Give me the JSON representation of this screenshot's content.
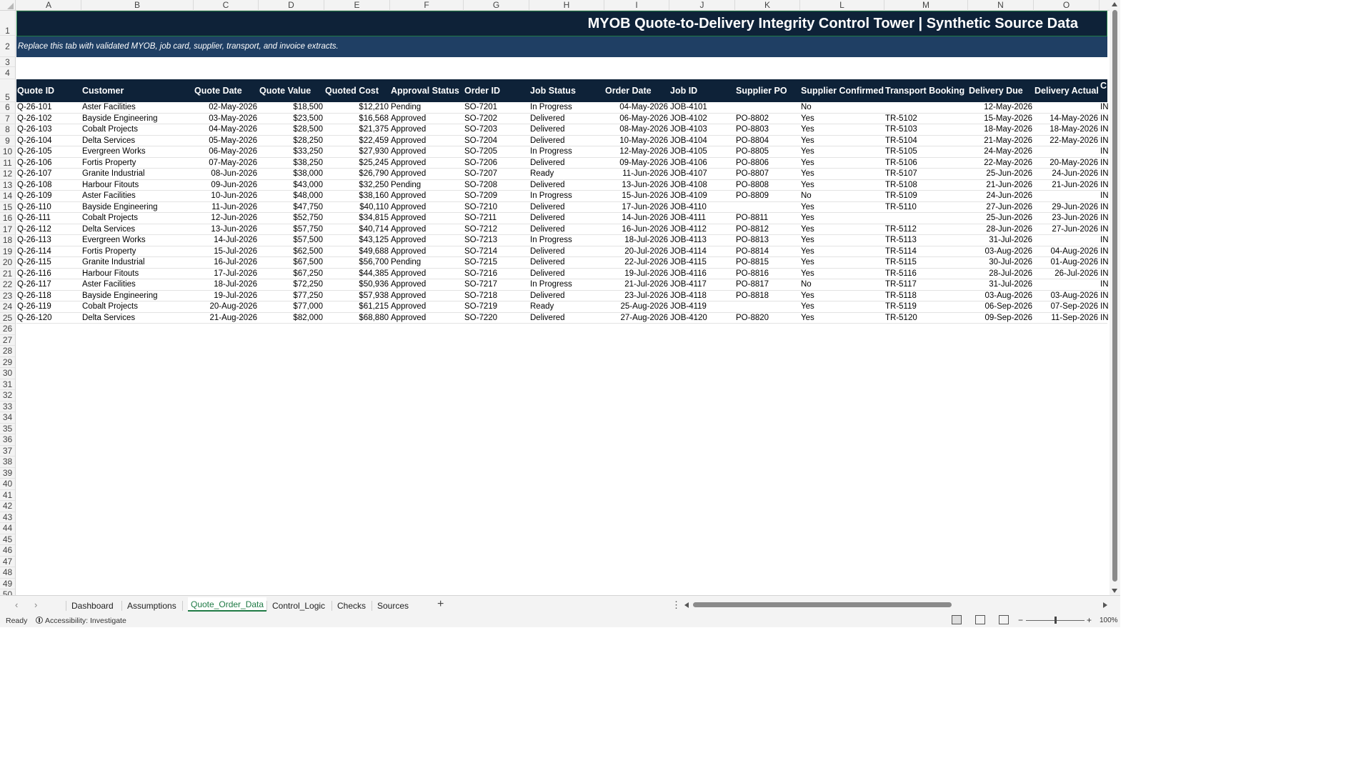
{
  "columns": [
    "A",
    "B",
    "C",
    "D",
    "E",
    "F",
    "G",
    "H",
    "I",
    "J",
    "K",
    "L",
    "M",
    "N",
    "O"
  ],
  "rows": [
    "1",
    "2",
    "3",
    "4",
    "5",
    "6",
    "7",
    "8",
    "9",
    "10",
    "11",
    "12",
    "13",
    "14",
    "15",
    "16",
    "17",
    "18",
    "19",
    "20",
    "21",
    "22",
    "23",
    "24",
    "25",
    "26",
    "27",
    "28",
    "29",
    "30",
    "31",
    "32",
    "33",
    "34",
    "35",
    "36",
    "37",
    "38",
    "39",
    "40",
    "41",
    "42",
    "43",
    "44",
    "45",
    "46",
    "47",
    "48",
    "49",
    "50"
  ],
  "sheet": {
    "title": "MYOB Quote-to-Delivery Integrity Control Tower | Synthetic Source Data",
    "subtitle": "Replace this tab with validated MYOB, job card, supplier, transport, and invoice extracts.",
    "headers": [
      "Quote ID",
      "Customer",
      "Quote Date",
      "Quote Value",
      "Quoted Cost",
      "Approval Status",
      "Order ID",
      "Job Status",
      "Order Date",
      "Job ID",
      "Supplier PO",
      "Supplier Confirmed",
      "Transport Booking",
      "Delivery Due",
      "Delivery Actual",
      "C In"
    ],
    "data": [
      [
        "Q-26-101",
        "Aster Facilities",
        "02-May-2026",
        "$18,500",
        "$12,210",
        "Pending",
        "SO-7201",
        "In Progress",
        "04-May-2026",
        "JOB-4101",
        "",
        "No",
        "",
        "12-May-2026",
        "",
        "IN"
      ],
      [
        "Q-26-102",
        "Bayside Engineering",
        "03-May-2026",
        "$23,500",
        "$16,568",
        "Approved",
        "SO-7202",
        "Delivered",
        "06-May-2026",
        "JOB-4102",
        "PO-8802",
        "Yes",
        "TR-5102",
        "15-May-2026",
        "14-May-2026",
        "IN"
      ],
      [
        "Q-26-103",
        "Cobalt Projects",
        "04-May-2026",
        "$28,500",
        "$21,375",
        "Approved",
        "SO-7203",
        "Delivered",
        "08-May-2026",
        "JOB-4103",
        "PO-8803",
        "Yes",
        "TR-5103",
        "18-May-2026",
        "18-May-2026",
        "IN"
      ],
      [
        "Q-26-104",
        "Delta Services",
        "05-May-2026",
        "$28,250",
        "$22,459",
        "Approved",
        "SO-7204",
        "Delivered",
        "10-May-2026",
        "JOB-4104",
        "PO-8804",
        "Yes",
        "TR-5104",
        "21-May-2026",
        "22-May-2026",
        "IN"
      ],
      [
        "Q-26-105",
        "Evergreen Works",
        "06-May-2026",
        "$33,250",
        "$27,930",
        "Approved",
        "SO-7205",
        "In Progress",
        "12-May-2026",
        "JOB-4105",
        "PO-8805",
        "Yes",
        "TR-5105",
        "24-May-2026",
        "",
        "IN"
      ],
      [
        "Q-26-106",
        "Fortis Property",
        "07-May-2026",
        "$38,250",
        "$25,245",
        "Approved",
        "SO-7206",
        "Delivered",
        "09-May-2026",
        "JOB-4106",
        "PO-8806",
        "Yes",
        "TR-5106",
        "22-May-2026",
        "20-May-2026",
        "IN"
      ],
      [
        "Q-26-107",
        "Granite Industrial",
        "08-Jun-2026",
        "$38,000",
        "$26,790",
        "Approved",
        "SO-7207",
        "Ready",
        "11-Jun-2026",
        "JOB-4107",
        "PO-8807",
        "Yes",
        "TR-5107",
        "25-Jun-2026",
        "24-Jun-2026",
        "IN"
      ],
      [
        "Q-26-108",
        "Harbour Fitouts",
        "09-Jun-2026",
        "$43,000",
        "$32,250",
        "Pending",
        "SO-7208",
        "Delivered",
        "13-Jun-2026",
        "JOB-4108",
        "PO-8808",
        "Yes",
        "TR-5108",
        "21-Jun-2026",
        "21-Jun-2026",
        "IN"
      ],
      [
        "Q-26-109",
        "Aster Facilities",
        "10-Jun-2026",
        "$48,000",
        "$38,160",
        "Approved",
        "SO-7209",
        "In Progress",
        "15-Jun-2026",
        "JOB-4109",
        "PO-8809",
        "No",
        "TR-5109",
        "24-Jun-2026",
        "",
        "IN"
      ],
      [
        "Q-26-110",
        "Bayside Engineering",
        "11-Jun-2026",
        "$47,750",
        "$40,110",
        "Approved",
        "SO-7210",
        "Delivered",
        "17-Jun-2026",
        "JOB-4110",
        "",
        "Yes",
        "TR-5110",
        "27-Jun-2026",
        "29-Jun-2026",
        "IN"
      ],
      [
        "Q-26-111",
        "Cobalt Projects",
        "12-Jun-2026",
        "$52,750",
        "$34,815",
        "Approved",
        "SO-7211",
        "Delivered",
        "14-Jun-2026",
        "JOB-4111",
        "PO-8811",
        "Yes",
        "",
        "25-Jun-2026",
        "23-Jun-2026",
        "IN"
      ],
      [
        "Q-26-112",
        "Delta Services",
        "13-Jun-2026",
        "$57,750",
        "$40,714",
        "Approved",
        "SO-7212",
        "Delivered",
        "16-Jun-2026",
        "JOB-4112",
        "PO-8812",
        "Yes",
        "TR-5112",
        "28-Jun-2026",
        "27-Jun-2026",
        "IN"
      ],
      [
        "Q-26-113",
        "Evergreen Works",
        "14-Jul-2026",
        "$57,500",
        "$43,125",
        "Approved",
        "SO-7213",
        "In Progress",
        "18-Jul-2026",
        "JOB-4113",
        "PO-8813",
        "Yes",
        "TR-5113",
        "31-Jul-2026",
        "",
        "IN"
      ],
      [
        "Q-26-114",
        "Fortis Property",
        "15-Jul-2026",
        "$62,500",
        "$49,688",
        "Approved",
        "SO-7214",
        "Delivered",
        "20-Jul-2026",
        "JOB-4114",
        "PO-8814",
        "Yes",
        "TR-5114",
        "03-Aug-2026",
        "04-Aug-2026",
        "IN"
      ],
      [
        "Q-26-115",
        "Granite Industrial",
        "16-Jul-2026",
        "$67,500",
        "$56,700",
        "Pending",
        "SO-7215",
        "Delivered",
        "22-Jul-2026",
        "JOB-4115",
        "PO-8815",
        "Yes",
        "TR-5115",
        "30-Jul-2026",
        "01-Aug-2026",
        "IN"
      ],
      [
        "Q-26-116",
        "Harbour Fitouts",
        "17-Jul-2026",
        "$67,250",
        "$44,385",
        "Approved",
        "SO-7216",
        "Delivered",
        "19-Jul-2026",
        "JOB-4116",
        "PO-8816",
        "Yes",
        "TR-5116",
        "28-Jul-2026",
        "26-Jul-2026",
        "IN"
      ],
      [
        "Q-26-117",
        "Aster Facilities",
        "18-Jul-2026",
        "$72,250",
        "$50,936",
        "Approved",
        "SO-7217",
        "In Progress",
        "21-Jul-2026",
        "JOB-4117",
        "PO-8817",
        "No",
        "TR-5117",
        "31-Jul-2026",
        "",
        "IN"
      ],
      [
        "Q-26-118",
        "Bayside Engineering",
        "19-Jul-2026",
        "$77,250",
        "$57,938",
        "Approved",
        "SO-7218",
        "Delivered",
        "23-Jul-2026",
        "JOB-4118",
        "PO-8818",
        "Yes",
        "TR-5118",
        "03-Aug-2026",
        "03-Aug-2026",
        "IN"
      ],
      [
        "Q-26-119",
        "Cobalt Projects",
        "20-Aug-2026",
        "$77,000",
        "$61,215",
        "Approved",
        "SO-7219",
        "Ready",
        "25-Aug-2026",
        "JOB-4119",
        "",
        "Yes",
        "TR-5119",
        "06-Sep-2026",
        "07-Sep-2026",
        "IN"
      ],
      [
        "Q-26-120",
        "Delta Services",
        "21-Aug-2026",
        "$82,000",
        "$68,880",
        "Approved",
        "SO-7220",
        "Delivered",
        "27-Aug-2026",
        "JOB-4120",
        "PO-8820",
        "Yes",
        "TR-5120",
        "09-Sep-2026",
        "11-Sep-2026",
        "IN"
      ]
    ]
  },
  "tabs": {
    "items": [
      "Dashboard",
      "Assumptions",
      "Quote_Order_Data",
      "Control_Logic",
      "Checks",
      "Sources"
    ],
    "active": "Quote_Order_Data",
    "add_symbol": "+",
    "menu_symbol": "⋮",
    "prev_symbol": "‹",
    "next_symbol": "›"
  },
  "status": {
    "ready": "Ready",
    "accessibility": "Accessibility: Investigate",
    "zoom_minus": "−",
    "zoom_plus": "+",
    "zoom_level": "100%",
    "zoom_fraction": 0.5
  },
  "colors": {
    "title_band": "#0e2238",
    "subtitle_band": "#1f3f64",
    "header_band": "#0e2238",
    "active_tab": "#1f7a45"
  }
}
